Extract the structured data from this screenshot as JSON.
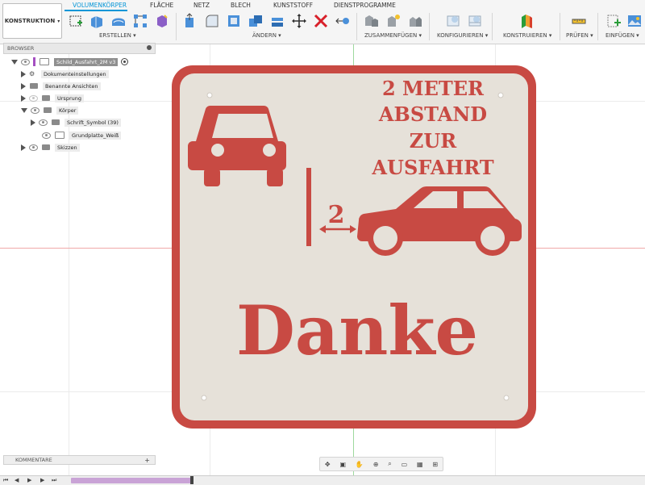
{
  "workspace": {
    "label": "KONSTRUKTION"
  },
  "tabs": [
    "VOLUMENKÖRPER",
    "FLÄCHE",
    "NETZ",
    "BLECH",
    "KUNSTSTOFF",
    "DIENSTPROGRAMME"
  ],
  "active_tab": "VOLUMENKÖRPER",
  "groups": [
    "ERSTELLEN ▾",
    "ÄNDERN ▾",
    "ZUSAMMENFÜGEN ▾",
    "KONFIGURIEREN ▾",
    "KONSTRUIEREN ▾",
    "PRÜFEN ▾",
    "EINFÜGEN ▾"
  ],
  "browser": {
    "title": "BROWSER",
    "root": "Schild_Ausfahrt_2M v3",
    "items": [
      "Dokumenteinstellungen",
      "Benannte Ansichten",
      "Ursprung",
      "Körper",
      "Schrift_Symbol (39)",
      "Grundplatte_Weiß",
      "Skizzen"
    ]
  },
  "comments": {
    "label": "KOMMENTARE",
    "add": "+"
  },
  "sign": {
    "line1": "2 METER",
    "line2": "ABSTAND",
    "line3": "ZUR",
    "line4": "AUSFAHRT",
    "distance": "2",
    "thanks": "Danke"
  },
  "colors": {
    "sign_red": "#c84a43",
    "sign_bg": "#e6e1d9",
    "accent": "#0696d7"
  }
}
